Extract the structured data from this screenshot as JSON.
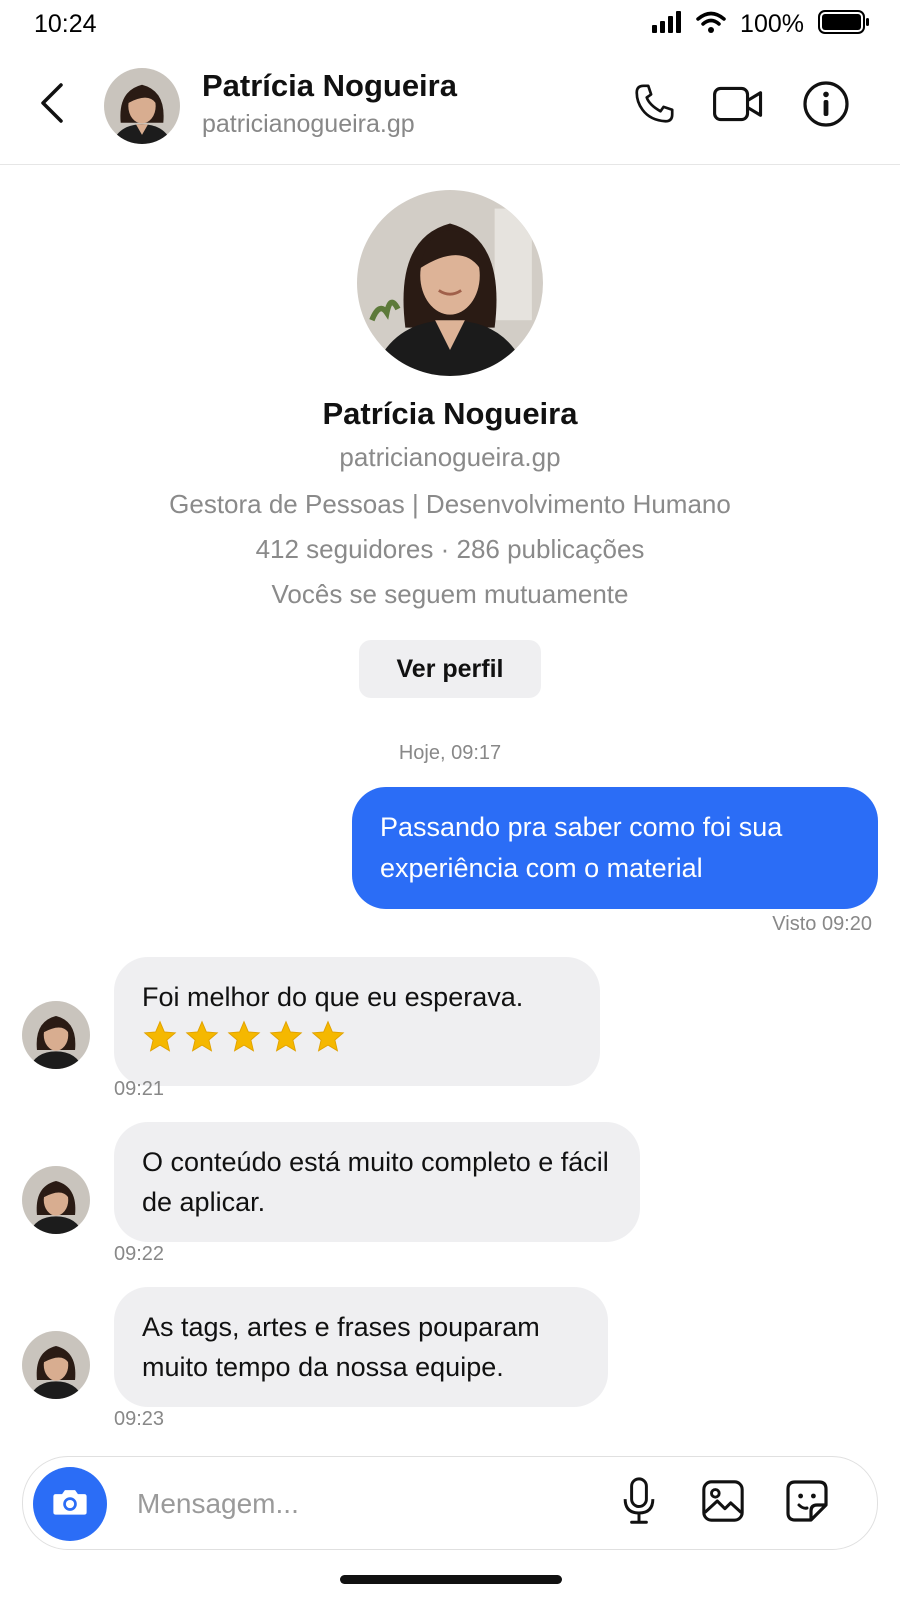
{
  "status": {
    "time": "10:24",
    "battery": "100%"
  },
  "header": {
    "name": "Patrícia Nogueira",
    "handle": "patricianogueira.gp"
  },
  "profile": {
    "name": "Patrícia Nogueira",
    "handle": "patricianogueira.gp",
    "bio": "Gestora de Pessoas | Desenvolvimento Humano",
    "stats": "412 seguidores · 286 publicações",
    "mutual": "Vocês se seguem mutuamente",
    "view_profile_label": "Ver perfil"
  },
  "thread": {
    "date_separator": "Hoje, 09:17",
    "outgoing": {
      "text": "Passando pra saber como foi sua experiência com o material",
      "seen": "Visto 09:20"
    },
    "incoming": [
      {
        "text": "Foi melhor do que eu esperava.",
        "stars": 5,
        "time": "09:21"
      },
      {
        "text": "O conteúdo está muito completo e fácil de aplicar.",
        "time": "09:22"
      },
      {
        "text": "As tags, artes e frases pouparam muito tempo da nossa equipe.",
        "time": "09:23"
      }
    ]
  },
  "composer": {
    "placeholder": "Mensagem..."
  },
  "colors": {
    "accent": "#2b6df6",
    "incoming_bubble": "#efeff1",
    "star": "#f5b800"
  },
  "icons": [
    "back-icon",
    "phone-icon",
    "video-icon",
    "info-icon",
    "camera-icon",
    "microphone-icon",
    "image-icon",
    "sticker-icon",
    "signal-icon",
    "wifi-icon",
    "battery-icon",
    "star-icon"
  ]
}
